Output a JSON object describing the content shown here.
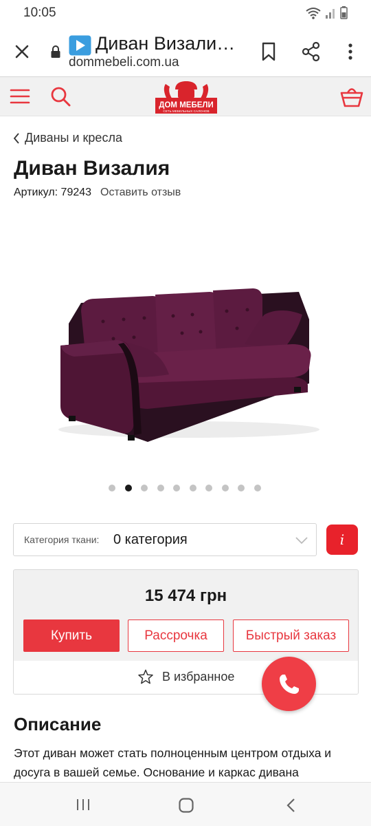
{
  "status_bar": {
    "time": "10:05"
  },
  "browser": {
    "page_title": "Диван Визали…",
    "url": "dommebeli.com.ua"
  },
  "site_header": {
    "logo_text": "ДОМ МЕБЕЛИ",
    "logo_subtext": "СЕТЬ МЕБЕЛЬНЫХ САЛОНОВ"
  },
  "breadcrumb": {
    "label": "Диваны и кресла"
  },
  "product": {
    "title": "Диван Визалия",
    "sku_label": "Артикул: 79243",
    "review_link": "Оставить отзыв",
    "gallery": {
      "total": 10,
      "active": 2
    }
  },
  "fabric": {
    "label": "Категория ткани:",
    "value": "0 категория",
    "info_label": "i"
  },
  "buy_box": {
    "price": "15 474 грн",
    "buy_label": "Купить",
    "installment_label": "Рассрочка",
    "quick_order_label": "Быстрый заказ",
    "favorite_label": "В избранное"
  },
  "description": {
    "heading": "Описание",
    "text": "Этот диван может стать полноценным центром отдыха и досуга в вашей семье. Основание  и каркас дивана"
  },
  "colors": {
    "brand_red": "#e8373f",
    "header_bg": "#f1f1f1",
    "sofa": "#5a1a3e"
  }
}
